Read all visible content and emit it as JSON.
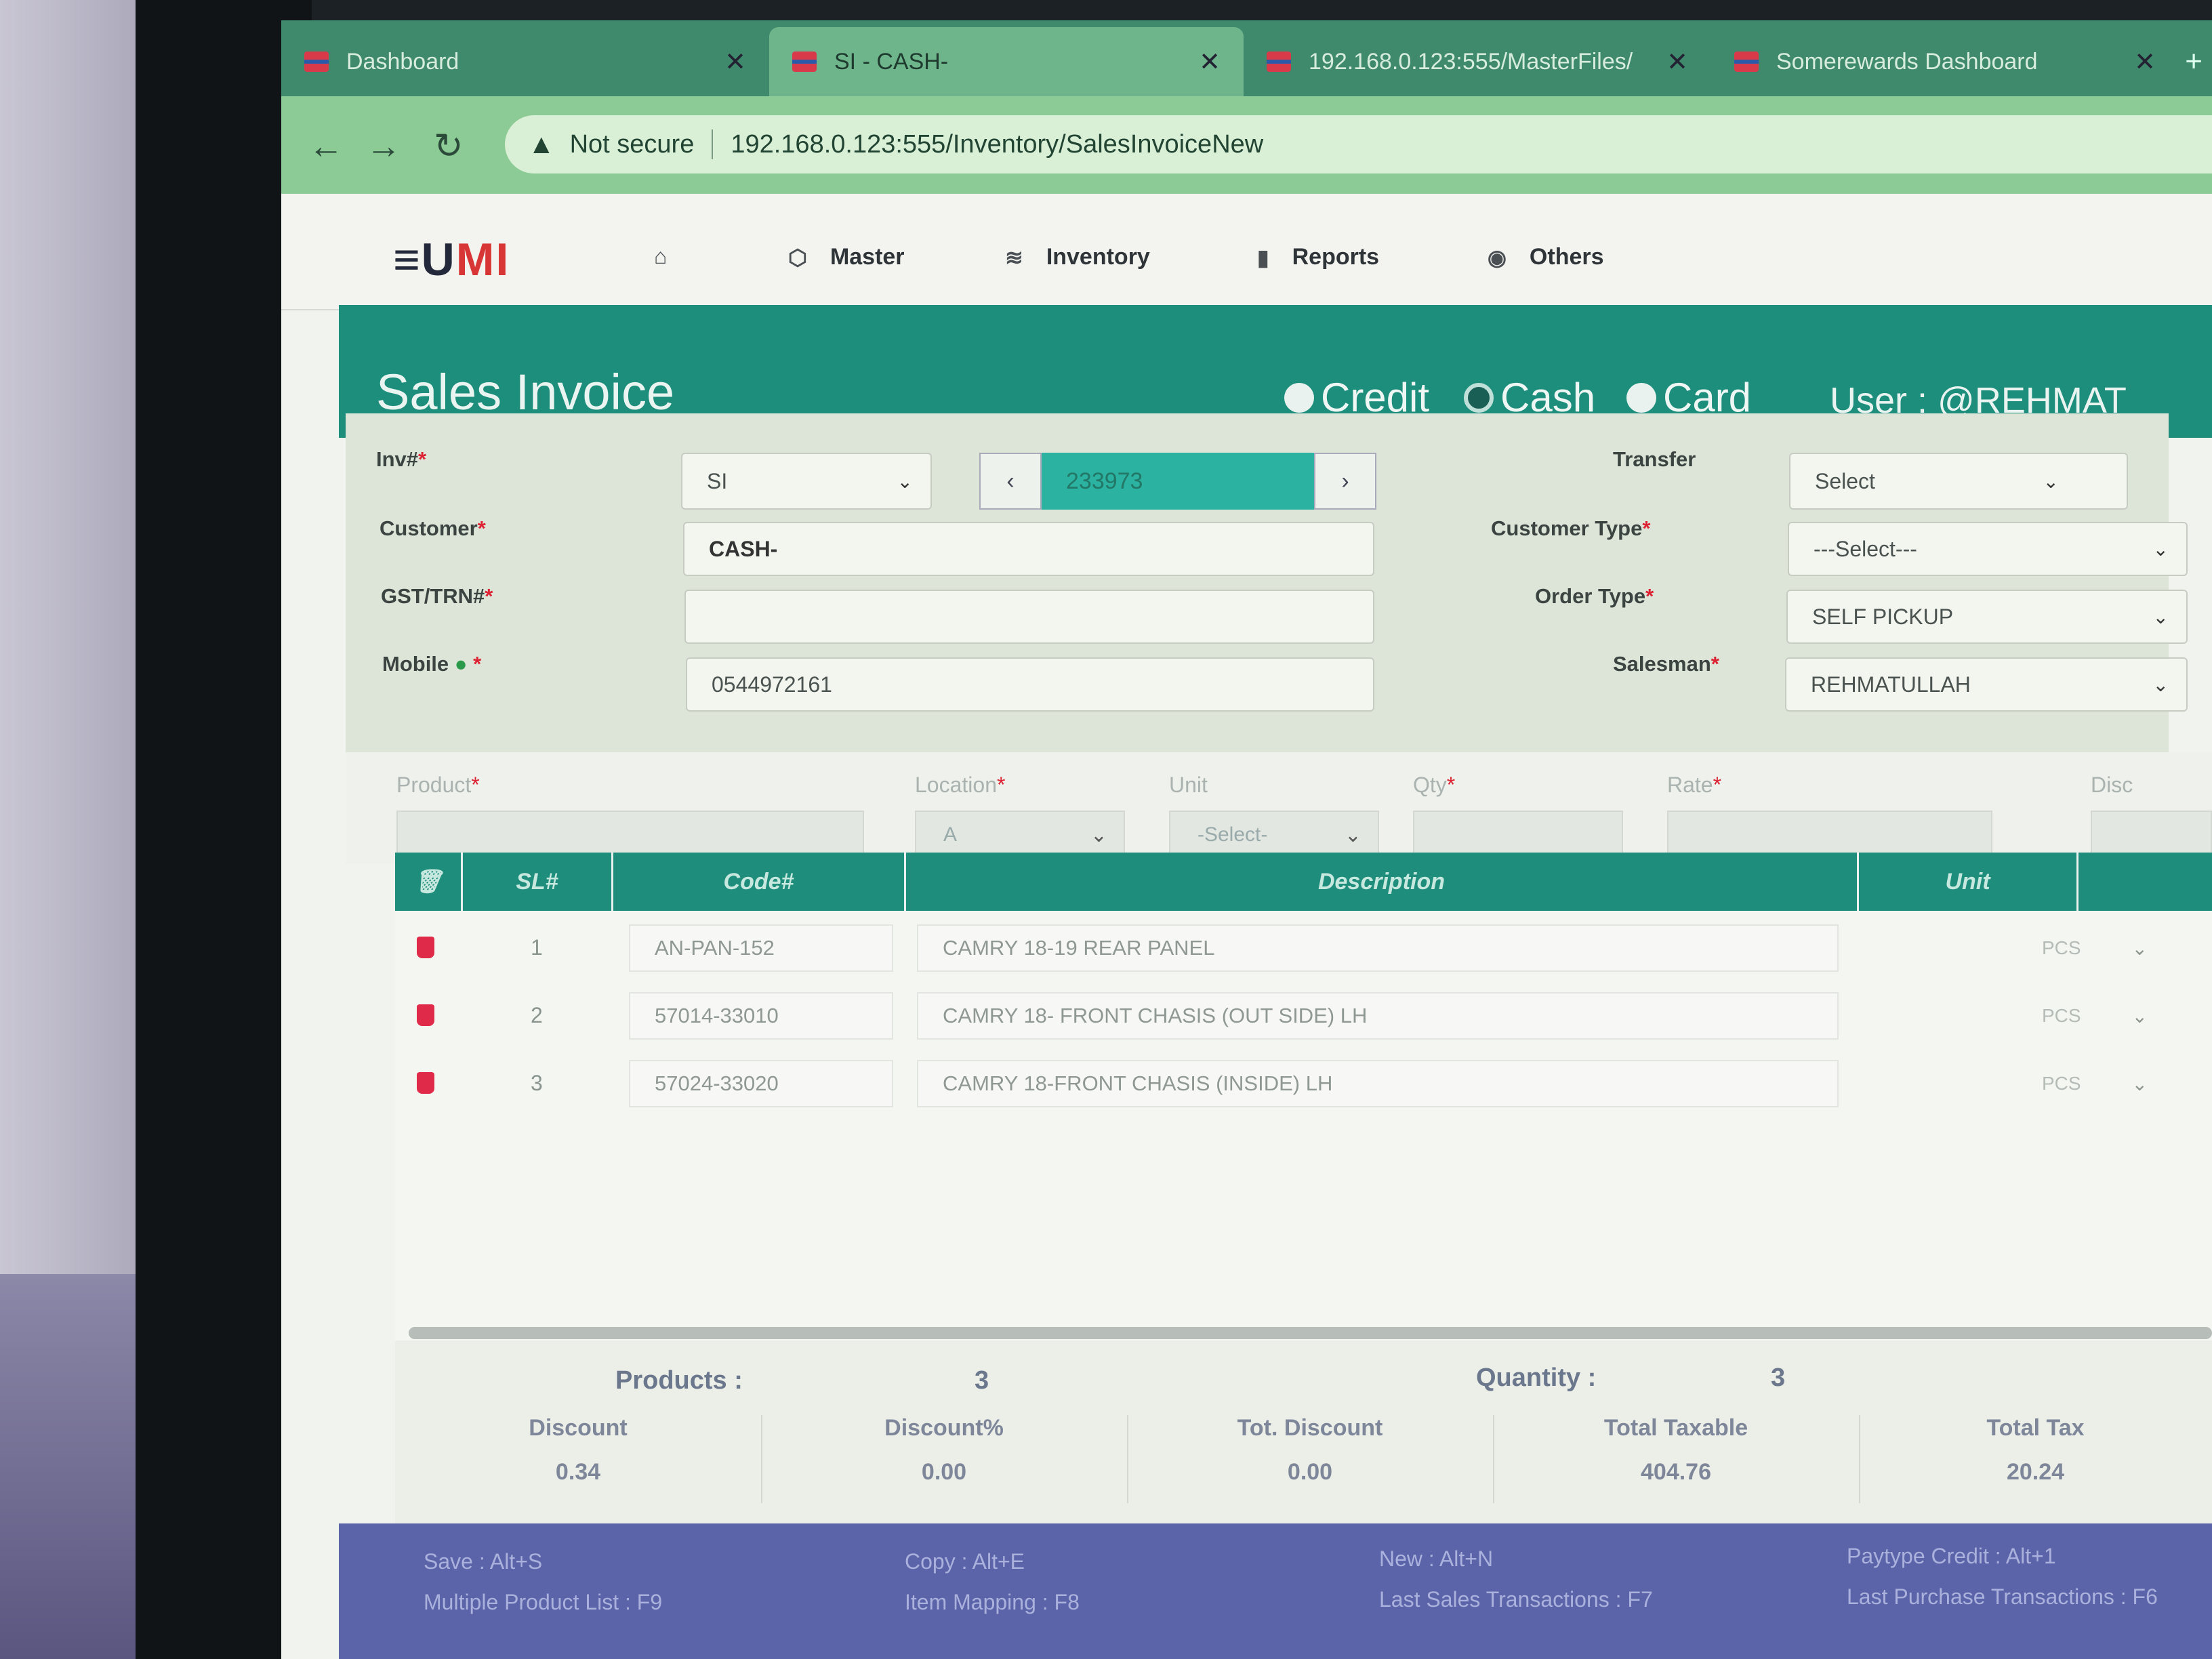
{
  "browser": {
    "tabs": [
      {
        "title": "Dashboard",
        "active": false
      },
      {
        "title": "SI - CASH-",
        "active": true
      },
      {
        "title": "192.168.0.123:555/MasterFiles/",
        "active": false
      },
      {
        "title": "Somerewards Dashboard",
        "active": false
      }
    ],
    "security_label": "Not secure",
    "url": "192.168.0.123:555/Inventory/SalesInvoiceNew"
  },
  "app": {
    "logo_main": "≡U",
    "logo_accent": "MI",
    "menu": [
      {
        "label": "Master",
        "icon": "cube-icon"
      },
      {
        "label": "Inventory",
        "icon": "layers-icon"
      },
      {
        "label": "Reports",
        "icon": "bar-chart-icon"
      },
      {
        "label": "Others",
        "icon": "globe-icon"
      }
    ]
  },
  "header": {
    "title": "Sales Invoice",
    "payment_modes": [
      {
        "label": "Credit",
        "selected": false
      },
      {
        "label": "Cash",
        "selected": true
      },
      {
        "label": "Card",
        "selected": false
      }
    ],
    "user": "User : @REHMAT"
  },
  "form": {
    "inv_label": "Inv#",
    "inv_prefix": "SI",
    "inv_number": "233973",
    "customer_label": "Customer",
    "customer_value": "CASH-",
    "gst_label": "GST/TRN#",
    "gst_value": "",
    "mobile_label": "Mobile",
    "mobile_value": "0544972161",
    "transfer_label": "Transfer",
    "transfer_value": "Select",
    "customer_type_label": "Customer Type",
    "customer_type_value": "---Select---",
    "order_type_label": "Order Type",
    "order_type_value": "SELF PICKUP",
    "salesman_label": "Salesman",
    "salesman_value": "REHMATULLAH"
  },
  "product_entry": {
    "product_label": "Product",
    "location_label": "Location",
    "location_value": "A",
    "unit_label": "Unit",
    "unit_value": "-Select-",
    "qty_label": "Qty",
    "rate_label": "Rate",
    "disc_label": "Disc"
  },
  "grid": {
    "columns": [
      "SL#",
      "Code#",
      "Description",
      "Unit"
    ],
    "rows": [
      {
        "sl": "1",
        "code": "AN-PAN-152",
        "description": "CAMRY 18-19 REAR PANEL",
        "unit": "PCS"
      },
      {
        "sl": "2",
        "code": "57014-33010",
        "description": "CAMRY 18- FRONT CHASIS (OUT SIDE) LH",
        "unit": "PCS"
      },
      {
        "sl": "3",
        "code": "57024-33020",
        "description": "CAMRY 18-FRONT CHASIS (INSIDE) LH",
        "unit": "PCS"
      }
    ]
  },
  "totals": {
    "products_label": "Products :",
    "products_value": "3",
    "quantity_label": "Quantity :",
    "quantity_value": "3",
    "columns": [
      {
        "label": "Discount",
        "value": "0.34"
      },
      {
        "label": "Discount%",
        "value": "0.00"
      },
      {
        "label": "Tot. Discount",
        "value": "0.00"
      },
      {
        "label": "Total Taxable",
        "value": "404.76"
      },
      {
        "label": "Total Tax",
        "value": "20.24"
      }
    ]
  },
  "shortcuts": [
    "Save : Alt+S",
    "Copy : Alt+E",
    "New : Alt+N",
    "Paytype Credit : Alt+1",
    "Multiple Product List : F9",
    "Item Mapping : F8",
    "Last Sales Transactions : F7",
    "Last Purchase Transactions : F6"
  ]
}
